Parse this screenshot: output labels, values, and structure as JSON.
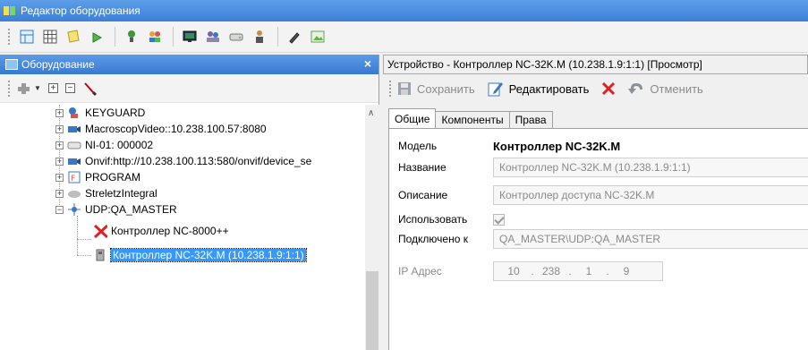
{
  "window": {
    "title": "Редактор оборудования"
  },
  "toolbar": {
    "icons": [
      "grid-view-icon",
      "table-icon",
      "notes-icon",
      "plant-icon",
      "user-pin-icon",
      "users-icon",
      "monitor-icon",
      "people-icon",
      "drive-icon",
      "person-icon",
      "pencil-tool-icon",
      "picture-icon"
    ]
  },
  "left": {
    "header": "Оборудование",
    "close": "×",
    "toolbar": {
      "add": "+",
      "expand": "⊞",
      "collapse": "⊟"
    },
    "tree": [
      {
        "label": "KEYGUARD",
        "icon": "keyguard-icon"
      },
      {
        "label": "MacroscopVideo::10.238.100.57:8080",
        "icon": "camera-icon"
      },
      {
        "label": "NI-01: 000002",
        "icon": "disk-icon"
      },
      {
        "label": "Onvif:http://10.238.100.113:580/onvif/device_se",
        "icon": "camera-icon"
      },
      {
        "label": "PROGRAM",
        "icon": "program-icon"
      },
      {
        "label": "StreletzIntegral",
        "icon": "cloud-icon"
      },
      {
        "label": "UDP:QA_MASTER",
        "icon": "network-icon"
      },
      {
        "label": "Контроллер NC-8000++",
        "icon": "error-x-icon"
      },
      {
        "label": "Контроллер NC-32K.M (10.238.1.9:1:1)",
        "icon": "controller-icon"
      }
    ]
  },
  "right": {
    "header": "Устройство - Контроллер NC-32K.M (10.238.1.9:1:1) [Просмотр]",
    "toolbar": {
      "save": "Сохранить",
      "edit": "Редактировать",
      "cancel": "Отменить"
    },
    "tabs": [
      "Общие",
      "Компоненты",
      "Права"
    ],
    "form": {
      "model_label": "Модель",
      "model_value": "Контроллер NC-32K.M",
      "name_label": "Название",
      "name_value": "Контроллер NC-32K.M (10.238.1.9:1:1)",
      "desc_label": "Описание",
      "desc_value": "Контроллер доступа NC-32K.M",
      "use_label": "Использовать",
      "conn_label": "Подключено к",
      "conn_value": "QA_MASTER\\UDP:QA_MASTER",
      "ip_label": "IP Адрес",
      "ip": [
        "10",
        "238",
        "1",
        "9"
      ],
      "ip_separator": "."
    }
  },
  "colors": {
    "accent": "#3399ff",
    "title": "#3d7fd6",
    "error": "#e02020"
  }
}
